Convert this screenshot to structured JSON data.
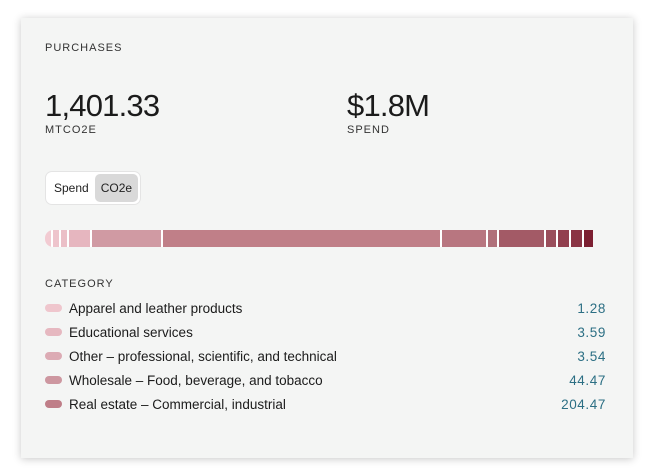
{
  "card": {
    "title": "PURCHASES"
  },
  "metrics": [
    {
      "value": "1,401.33",
      "label": "MTCO2E"
    },
    {
      "value": "$1.8M",
      "label": "SPEND"
    }
  ],
  "toggle": {
    "options": [
      "Spend",
      "CO2e"
    ],
    "selected": "CO2e"
  },
  "breakdown_bar": {
    "segments": [
      {
        "share": 0.011,
        "color": "#f2cbd2"
      },
      {
        "share": 0.011,
        "color": "#eec4cc"
      },
      {
        "share": 0.011,
        "color": "#ebbfc7"
      },
      {
        "share": 0.039,
        "color": "#e6b6bf"
      },
      {
        "share": 0.129,
        "color": "#d09aa3"
      },
      {
        "share": 0.517,
        "color": "#c07f88"
      },
      {
        "share": 0.082,
        "color": "#b87680"
      },
      {
        "share": 0.018,
        "color": "#b0707a"
      },
      {
        "share": 0.084,
        "color": "#a35a66"
      },
      {
        "share": 0.018,
        "color": "#9a4e5b"
      },
      {
        "share": 0.021,
        "color": "#923f4e"
      },
      {
        "share": 0.02,
        "color": "#8a3444"
      },
      {
        "share": 0.016,
        "color": "#7c1f31"
      }
    ]
  },
  "categories": {
    "header": "CATEGORY",
    "items": [
      {
        "label": "Apparel and leather products",
        "value": "1.28",
        "color": "#efc6cd"
      },
      {
        "label": "Educational services",
        "value": "3.59",
        "color": "#e6b8c0"
      },
      {
        "label": "Other – professional, scientific, and technical",
        "value": "3.54",
        "color": "#dcabb4"
      },
      {
        "label": "Wholesale – Food, beverage, and tobacco",
        "value": "44.47",
        "color": "#cd97a0"
      },
      {
        "label": "Real estate – Commercial, industrial",
        "value": "204.47",
        "color": "#bf7e88"
      }
    ]
  }
}
